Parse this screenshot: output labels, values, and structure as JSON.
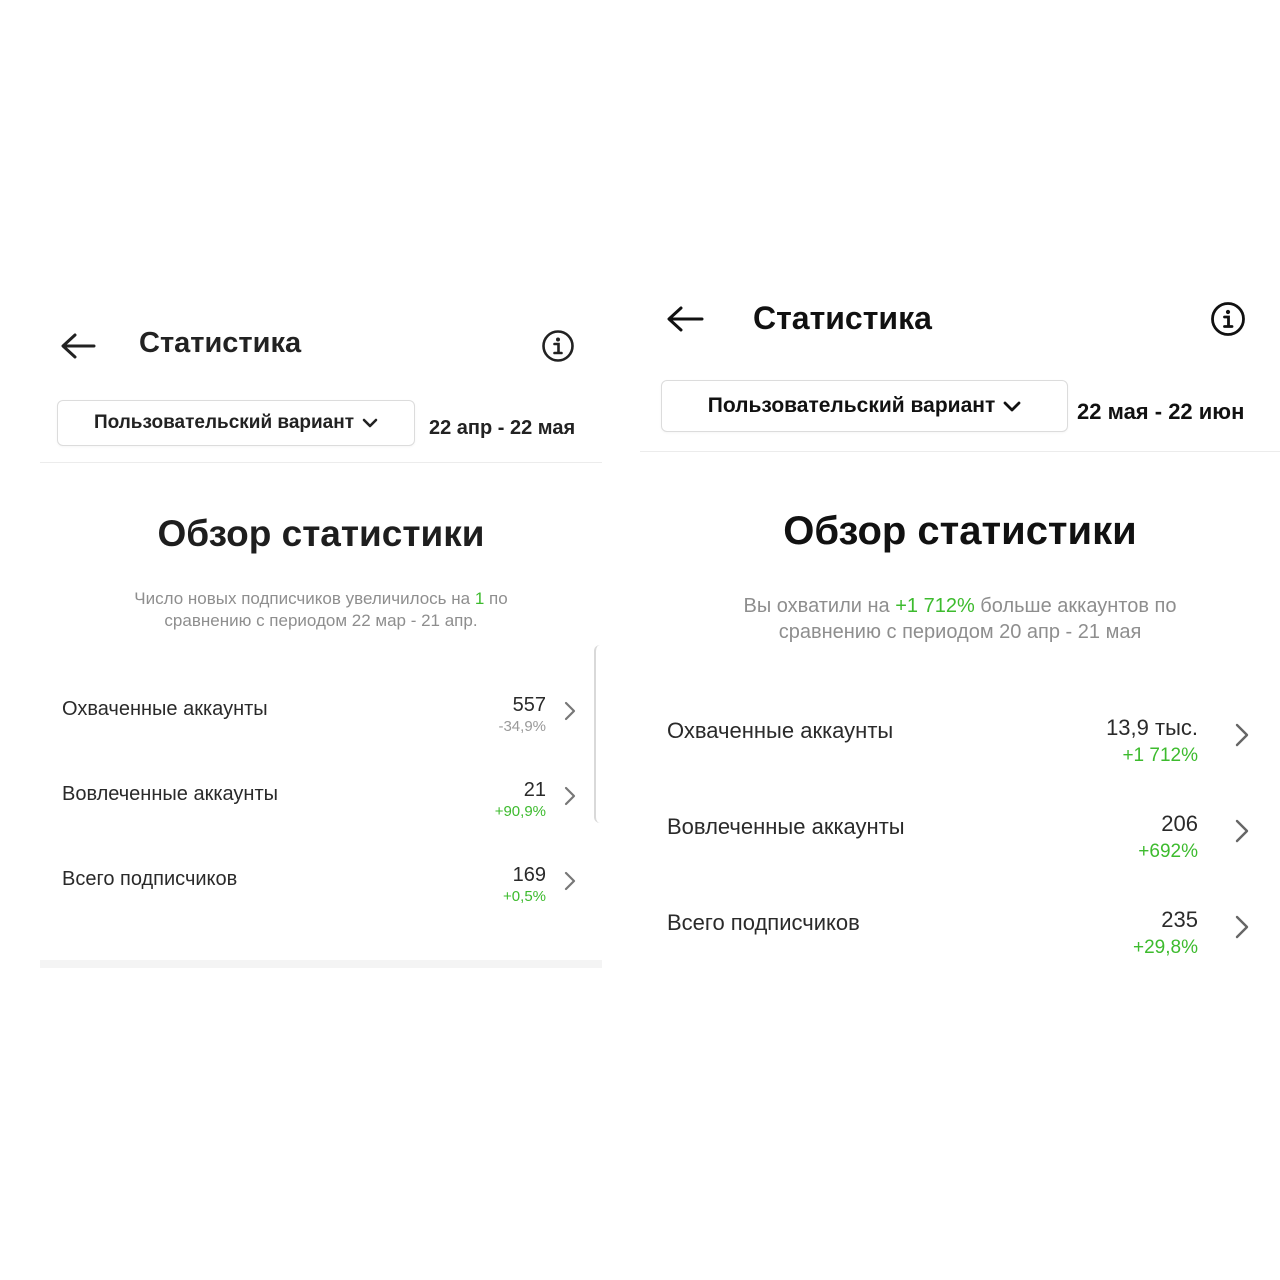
{
  "left": {
    "header": {
      "title": "Статистика"
    },
    "filter": {
      "range_label": "Пользовательский вариант",
      "dates": "22 апр - 22 мая"
    },
    "overview": {
      "title": "Обзор статистики",
      "summary_before": "Число новых подписчиков увеличилось на ",
      "summary_highlight": "1",
      "summary_after": " по сравнению с периодом 22 мар - 21 апр."
    },
    "metrics": [
      {
        "label": "Охваченные аккаунты",
        "value": "557",
        "change": "-34,9%"
      },
      {
        "label": "Вовлеченные аккаунты",
        "value": "21",
        "change": "+90,9%"
      },
      {
        "label": "Всего подписчиков",
        "value": "169",
        "change": "+0,5%"
      }
    ]
  },
  "right": {
    "header": {
      "title": "Статистика"
    },
    "filter": {
      "range_label": "Пользовательский вариант",
      "dates": "22 мая - 22 июн"
    },
    "overview": {
      "title": "Обзор статистики",
      "summary_before": "Вы охватили на ",
      "summary_highlight": "+1 712%",
      "summary_after": " больше аккаунтов по сравнению с периодом 20 апр - 21 мая"
    },
    "metrics": [
      {
        "label": "Охваченные аккаунты",
        "value": "13,9 тыс.",
        "change": "+1 712%"
      },
      {
        "label": "Вовлеченные аккаунты",
        "value": "206",
        "change": "+692%"
      },
      {
        "label": "Всего подписчиков",
        "value": "235",
        "change": "+29,8%"
      }
    ]
  },
  "colors": {
    "positive": "#3dbb2e",
    "negative": "#9a9a9a",
    "muted": "#8e8e8e"
  },
  "icons": {
    "back": "arrow-left-icon",
    "info": "info-circle-icon",
    "chevron": "chevron-right-icon",
    "dropdown": "chevron-down-icon"
  }
}
